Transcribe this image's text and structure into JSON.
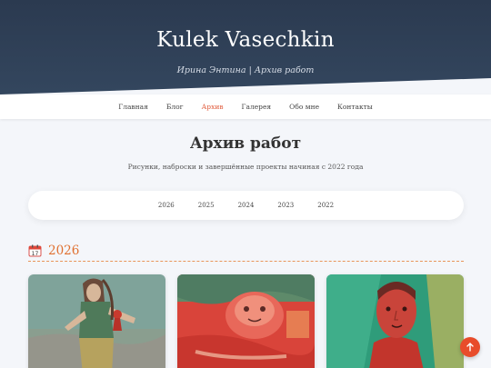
{
  "header": {
    "site_title": "Kulek Vasechkin",
    "subtitle": "Ирина Энтина | Архив работ"
  },
  "nav": {
    "items": [
      {
        "label": "Главная"
      },
      {
        "label": "Блог"
      },
      {
        "label": "Архив",
        "active": true
      },
      {
        "label": "Галерея"
      },
      {
        "label": "Обо мне"
      },
      {
        "label": "Контакты"
      }
    ]
  },
  "main": {
    "title": "Архив работ",
    "description": "Рисунки, наброски и завершённые проекты начиная с 2022 года",
    "year_filter": [
      "2026",
      "2025",
      "2024",
      "2023",
      "2022"
    ],
    "section": {
      "icon": "calendar-icon",
      "year": "2026"
    },
    "cards": [
      {
        "image": "artwork-figure-with-puppet"
      },
      {
        "image": "artwork-red-creature"
      },
      {
        "image": "artwork-red-portrait"
      }
    ]
  },
  "scroll_top_button": {
    "icon": "arrow-up-icon"
  },
  "colors": {
    "header_bg": "#2b3a50",
    "accent": "#e05a3a",
    "section_year": "#e07030"
  }
}
